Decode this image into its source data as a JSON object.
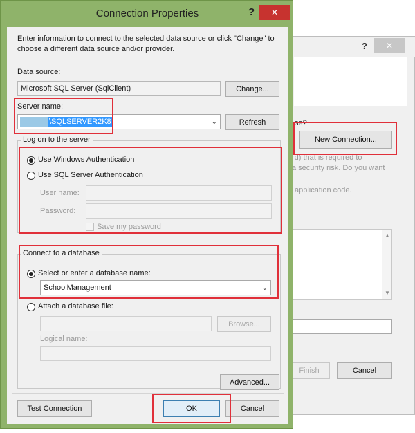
{
  "background_dialog": {
    "help_glyph": "?",
    "close_glyph": "✕",
    "partial_question_fragment": "se?",
    "new_connection_label": "New Connection...",
    "text_line1_fragment": "rd) that is required to",
    "text_line2_fragment": "a security risk. Do you want",
    "text_line3_fragment": "application code.",
    "finish_label": "Finish",
    "cancel_label": "Cancel"
  },
  "dialog": {
    "title": "Connection Properties",
    "help_glyph": "?",
    "close_glyph": "✕",
    "intro": "Enter information to connect to the selected data source or click \"Change\" to choose a different data source and/or provider.",
    "data_source_label": "Data source:",
    "data_source_value": "Microsoft SQL Server (SqlClient)",
    "change_label": "Change...",
    "server_name_label": "Server name:",
    "server_name_value": "\\SQLSERVER2K8",
    "refresh_label": "Refresh",
    "logon_group_title": "Log on to the server",
    "windows_auth_label": "Use Windows Authentication",
    "sql_auth_label": "Use SQL Server Authentication",
    "user_name_label": "User name:",
    "password_label": "Password:",
    "save_password_label": "Save my password",
    "connect_group_title": "Connect to a database",
    "select_db_label": "Select or enter a database name:",
    "database_value": "SchoolManagement",
    "attach_db_label": "Attach a database file:",
    "browse_label": "Browse...",
    "logical_name_label": "Logical name:",
    "advanced_label": "Advanced...",
    "test_connection_label": "Test Connection",
    "ok_label": "OK",
    "cancel_label": "Cancel"
  },
  "colors": {
    "frame_green": "#8fb36a",
    "highlight_red": "#e0303a",
    "close_red": "#c7332f",
    "selection_blue": "#3399ff"
  }
}
